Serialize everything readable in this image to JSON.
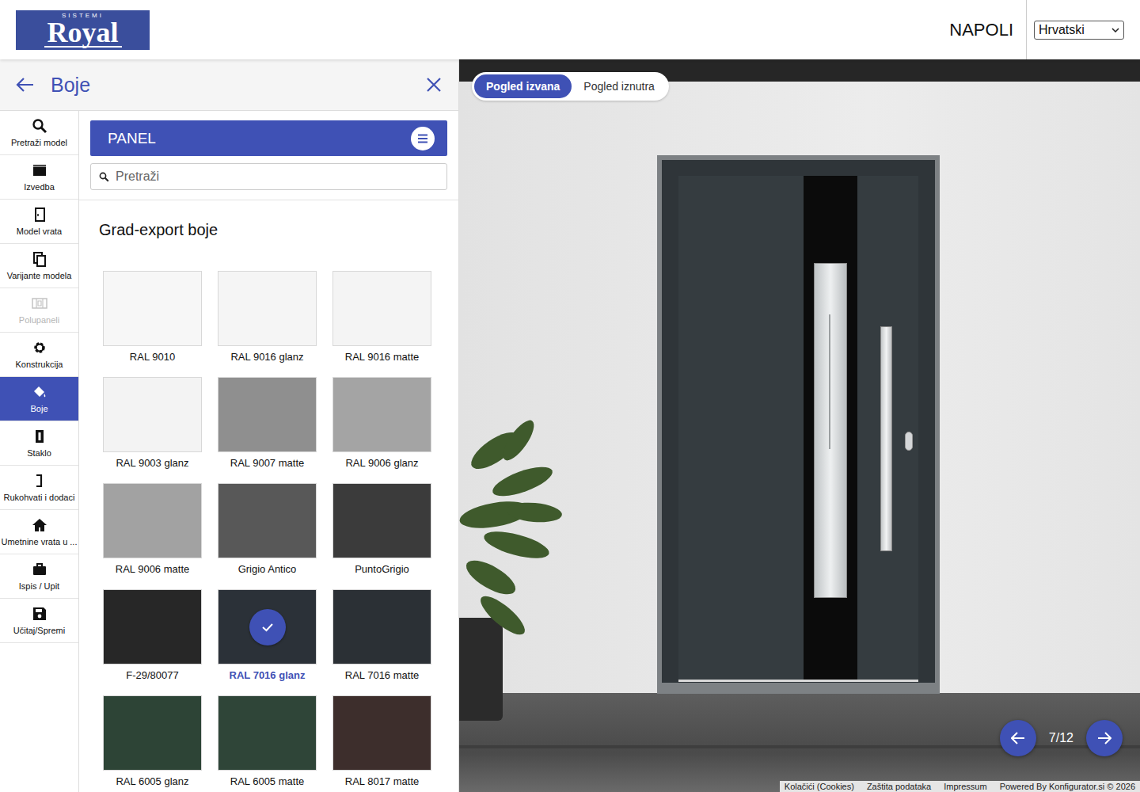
{
  "header": {
    "logo": {
      "sub": "SISTEMI",
      "brand": "Royal"
    },
    "model": "NAPOLI",
    "language": "Hrvatski"
  },
  "panel": {
    "title": "Boje"
  },
  "sidebar": {
    "items": [
      {
        "label": "Pretraži model",
        "selected": false,
        "disabled": false
      },
      {
        "label": "Izvedba",
        "selected": false,
        "disabled": false
      },
      {
        "label": "Model vrata",
        "selected": false,
        "disabled": false
      },
      {
        "label": "Varijante modela",
        "selected": false,
        "disabled": false
      },
      {
        "label": "Polupaneli",
        "selected": false,
        "disabled": true
      },
      {
        "label": "Konstrukcija",
        "selected": false,
        "disabled": false
      },
      {
        "label": "Boje",
        "selected": true,
        "disabled": false
      },
      {
        "label": "Staklo",
        "selected": false,
        "disabled": false
      },
      {
        "label": "Rukohvati i dodaci",
        "selected": false,
        "disabled": false
      },
      {
        "label": "Umetnine vrata u ...",
        "selected": false,
        "disabled": false
      },
      {
        "label": "Ispis / Upit",
        "selected": false,
        "disabled": false
      },
      {
        "label": "Učitaj/Spremi",
        "selected": false,
        "disabled": false
      }
    ]
  },
  "section": {
    "title": "PANEL"
  },
  "search": {
    "placeholder": "Pretraži"
  },
  "group": {
    "title": "Grad-export boje",
    "swatches": [
      {
        "label": "RAL 9010",
        "color": "#f7f7f7",
        "selected": false
      },
      {
        "label": "RAL 9016 glanz",
        "color": "#f5f5f5",
        "selected": false
      },
      {
        "label": "RAL 9016 matte",
        "color": "#f4f4f4",
        "selected": false
      },
      {
        "label": "RAL 9003 glanz",
        "color": "#f3f3f3",
        "selected": false
      },
      {
        "label": "RAL 9007 matte",
        "color": "#8f8f8f",
        "selected": false
      },
      {
        "label": "RAL 9006 glanz",
        "color": "#a4a4a4",
        "selected": false
      },
      {
        "label": "RAL 9006 matte",
        "color": "#a2a2a2",
        "selected": false
      },
      {
        "label": "Grigio Antico",
        "color": "#585858",
        "selected": false
      },
      {
        "label": "PuntoGrigio",
        "color": "#3b3b3b",
        "selected": false
      },
      {
        "label": "F-29/80077",
        "color": "#272727",
        "selected": false
      },
      {
        "label": "RAL 7016 glanz",
        "color": "#2b3138",
        "selected": true
      },
      {
        "label": "RAL 7016 matte",
        "color": "#2b3035",
        "selected": false
      },
      {
        "label": "RAL 6005 glanz",
        "color": "#2d4436",
        "selected": false
      },
      {
        "label": "RAL 6005 matte",
        "color": "#2f4538",
        "selected": false
      },
      {
        "label": "RAL 8017 matte",
        "color": "#3d2e2c",
        "selected": false
      }
    ]
  },
  "preview": {
    "views": [
      {
        "label": "Pogled izvana",
        "selected": true
      },
      {
        "label": "Pogled iznutra",
        "selected": false
      }
    ],
    "pager": "7/12",
    "footer_links": [
      "Kolačići (Cookies)",
      "Zaštita podataka",
      "Impressum",
      "Powered By Konfigurator.si © 2026"
    ]
  }
}
